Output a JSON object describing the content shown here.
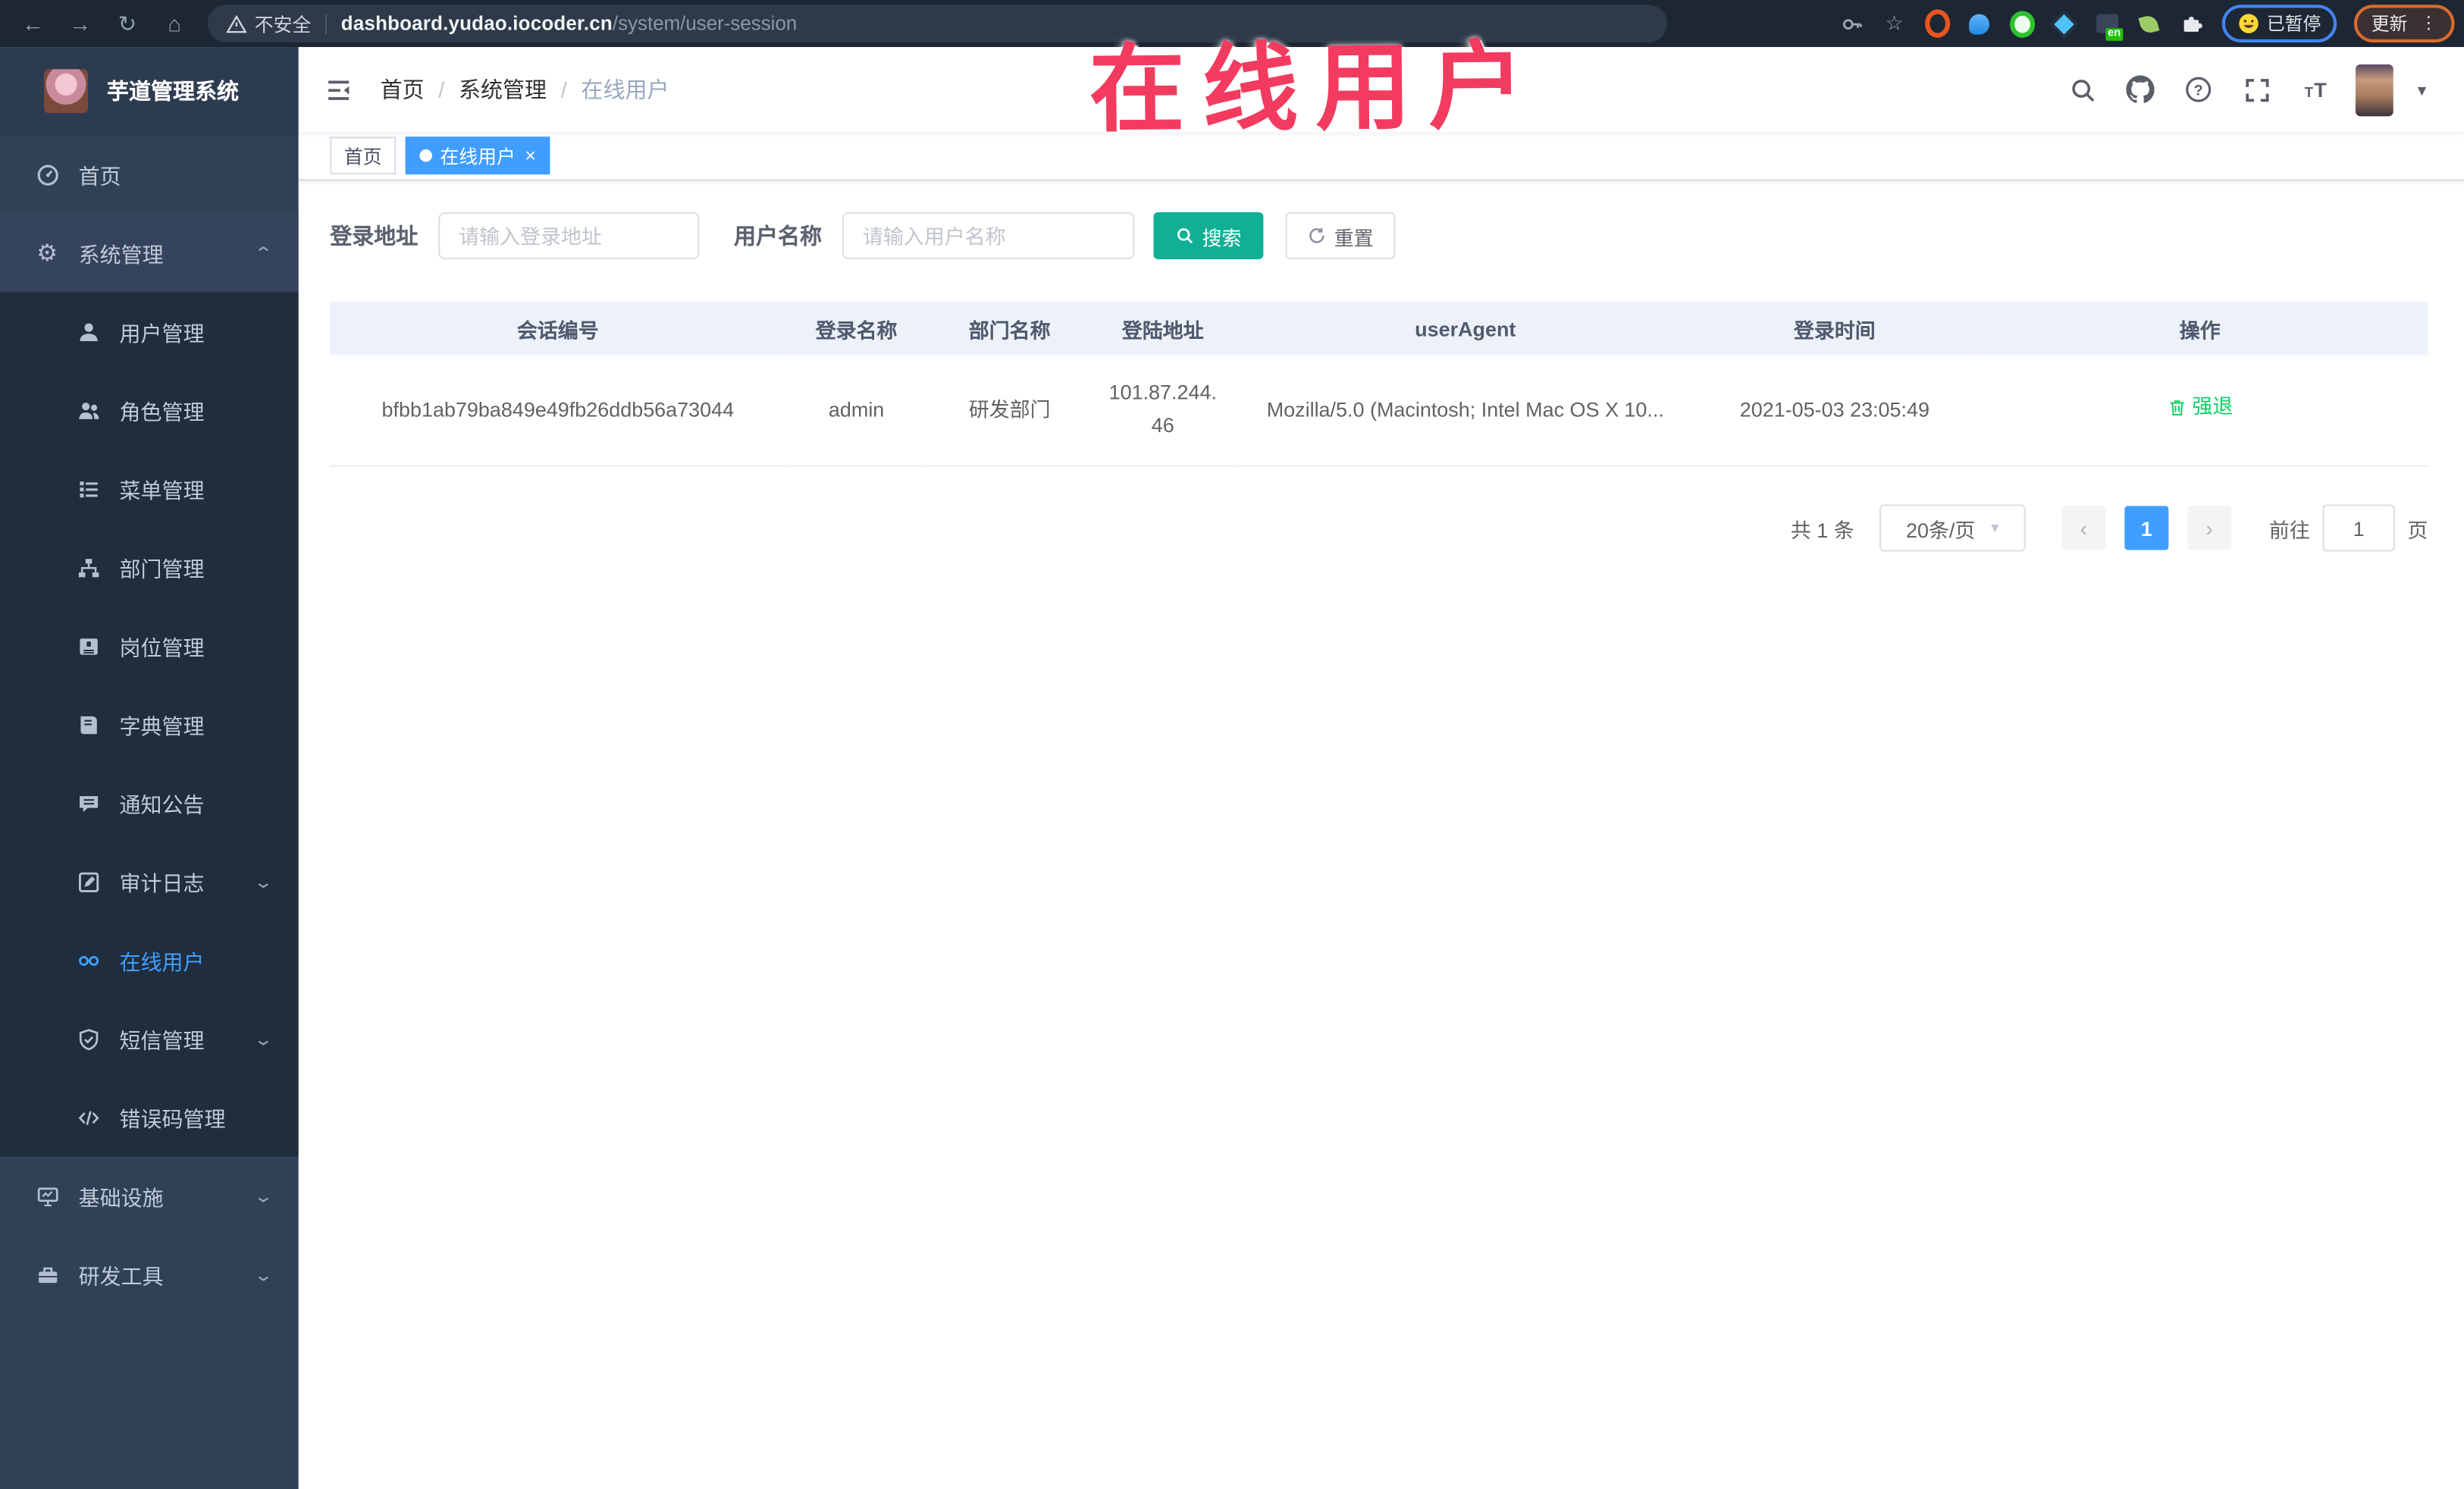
{
  "browser": {
    "security_text": "不安全",
    "url_host": "dashboard.yudao.iocoder.cn",
    "url_path": "/system/user-session",
    "paused_badge": "已暂停",
    "update_button": "更新"
  },
  "annotation": {
    "text": "在线用户",
    "color": "#f23b5f"
  },
  "sidebar": {
    "logo_title": "芋道管理系统",
    "items": [
      {
        "label": "首页"
      },
      {
        "label": "系统管理"
      },
      {
        "label": "用户管理"
      },
      {
        "label": "角色管理"
      },
      {
        "label": "菜单管理"
      },
      {
        "label": "部门管理"
      },
      {
        "label": "岗位管理"
      },
      {
        "label": "字典管理"
      },
      {
        "label": "通知公告"
      },
      {
        "label": "审计日志"
      },
      {
        "label": "在线用户"
      },
      {
        "label": "短信管理"
      },
      {
        "label": "错误码管理"
      },
      {
        "label": "基础设施"
      },
      {
        "label": "研发工具"
      }
    ]
  },
  "header": {
    "breadcrumb": [
      "首页",
      "系统管理",
      "在线用户"
    ]
  },
  "tabs": [
    {
      "label": "首页",
      "active": false
    },
    {
      "label": "在线用户",
      "active": true
    }
  ],
  "filters": {
    "login_address_label": "登录地址",
    "login_address_placeholder": "请输入登录地址",
    "username_label": "用户名称",
    "username_placeholder": "请输入用户名称",
    "search_label": "搜索",
    "reset_label": "重置"
  },
  "table": {
    "columns": [
      "会话编号",
      "登录名称",
      "部门名称",
      "登陆地址",
      "userAgent",
      "登录时间",
      "操作"
    ],
    "rows": [
      {
        "session_id": "bfbb1ab79ba849e49fb26ddb56a73044",
        "login_name": "admin",
        "dept_name": "研发部门",
        "login_ip": "101.87.244.46",
        "user_agent": "Mozilla/5.0 (Macintosh; Intel Mac OS X 10...",
        "login_time": "2021-05-03 23:05:49",
        "action": "强退"
      }
    ]
  },
  "pagination": {
    "total_text": "共 1 条",
    "page_size": "20条/页",
    "current_page": "1",
    "goto_label": "前往",
    "goto_value": "1",
    "page_unit": "页"
  },
  "colors": {
    "accent": "#409eff",
    "teal": "#11b095",
    "success": "#13ce66",
    "annotation": "#f23b5f"
  }
}
